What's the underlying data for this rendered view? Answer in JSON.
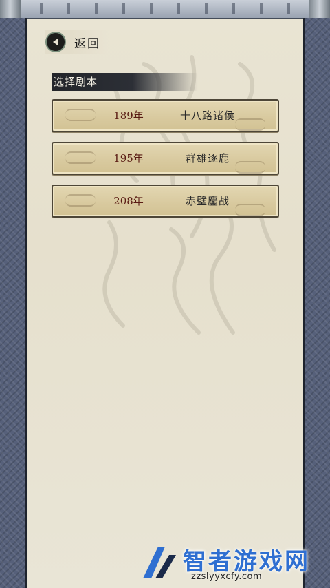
{
  "header": {
    "back_label": "返回",
    "back_icon": "arrow-left-icon"
  },
  "section": {
    "title": "选择剧本"
  },
  "scenarios": [
    {
      "year": "189年",
      "name": "十八路诸侯"
    },
    {
      "year": "195年",
      "name": "群雄逐鹿"
    },
    {
      "year": "208年",
      "name": "赤壁鏖战"
    }
  ],
  "watermark": {
    "title": "智者游戏网",
    "url": "zzslyyxcfy.com"
  },
  "colors": {
    "frame": "#56607a",
    "paper": "#e9e4d3",
    "button_face": "#d8c99e",
    "year_text": "#5a1c14",
    "watermark_blue": "#2f6fd1"
  }
}
